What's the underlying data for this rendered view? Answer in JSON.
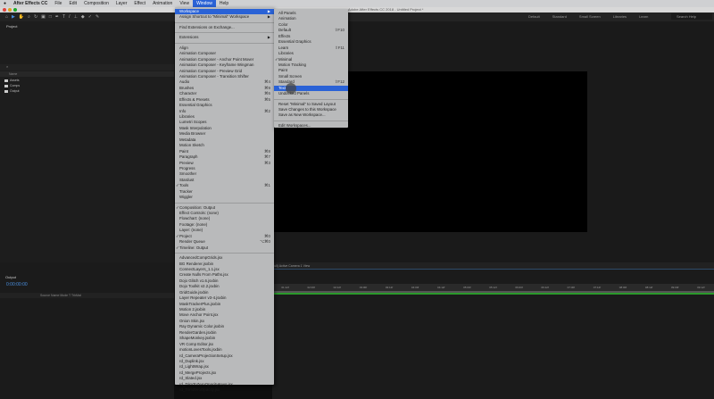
{
  "menubar": {
    "apple": "",
    "app": "After Effects CC",
    "items": [
      "File",
      "Edit",
      "Composition",
      "Layer",
      "Effect",
      "Animation",
      "View",
      "Window",
      "Help"
    ],
    "active": "Window"
  },
  "titlebar": {
    "title": "Adobe After Effects CC 2018 - Untitled Project *"
  },
  "toolbar": {
    "workspaces": [
      "Default",
      "Standard",
      "Small Screen",
      "Libraries",
      "Learn"
    ],
    "search_placeholder": "Search Help"
  },
  "project": {
    "tab": "Project",
    "column": "Name",
    "items": [
      "Assets",
      "Comps",
      "Output"
    ]
  },
  "viewer": {
    "toolbar": "(Full)   Active Camera   1 View"
  },
  "timeline": {
    "tab": "Output",
    "timecode": "0:00:00:00",
    "columns": "Source Name          Mode     T  TrkMat",
    "ruler": [
      "01:12f",
      "02:00f",
      "02:12f",
      "03:00f",
      "03:12f",
      "04:00f",
      "04:12f",
      "05:00f",
      "05:12f",
      "06:00f",
      "06:12f",
      "07:00f",
      "07:12f",
      "08:00f",
      "08:12f",
      "09:00f",
      "09:12f"
    ]
  },
  "window_menu": [
    {
      "label": "Workspace",
      "submenu": true,
      "highlight": true
    },
    {
      "label": "Assign Shortcut to \"Minimal\" Workspace",
      "submenu": true
    },
    {
      "sep": true
    },
    {
      "label": "Find Extensions on Exchange..."
    },
    {
      "sep": true
    },
    {
      "label": "Extensions",
      "submenu": true
    },
    {
      "sep": true
    },
    {
      "label": "Align"
    },
    {
      "label": "Animation Composer"
    },
    {
      "label": "Animation Composer - Anchor Point Mover"
    },
    {
      "label": "Animation Composer - Keyframe Wingman"
    },
    {
      "label": "Animation Composer - Preview Grid"
    },
    {
      "label": "Animation Composer - Transition Shifter"
    },
    {
      "label": "Audio",
      "shortcut": "⌘4"
    },
    {
      "label": "Brushes",
      "shortcut": "⌘9"
    },
    {
      "label": "Character",
      "shortcut": "⌘6"
    },
    {
      "label": "Effects & Presets",
      "shortcut": "⌘5"
    },
    {
      "label": "Essential Graphics"
    },
    {
      "label": "Info",
      "shortcut": "⌘2"
    },
    {
      "label": "Libraries"
    },
    {
      "label": "Lumetri Scopes"
    },
    {
      "label": "Mask Interpolation"
    },
    {
      "label": "Media Browser"
    },
    {
      "label": "Metadata"
    },
    {
      "label": "Motion Sketch"
    },
    {
      "label": "Paint",
      "shortcut": "⌘8"
    },
    {
      "label": "Paragraph",
      "shortcut": "⌘7"
    },
    {
      "label": "Preview",
      "shortcut": "⌘3"
    },
    {
      "label": "Progress"
    },
    {
      "label": "Smoother"
    },
    {
      "label": "Stardust"
    },
    {
      "label": "Tools",
      "shortcut": "⌘1",
      "checked": true
    },
    {
      "label": "Tracker"
    },
    {
      "label": "Wiggler"
    },
    {
      "sep": true
    },
    {
      "label": "Composition: Output",
      "checked": true
    },
    {
      "label": "Effect Controls: (none)"
    },
    {
      "label": "Flowchart: (none)"
    },
    {
      "label": "Footage: (none)"
    },
    {
      "label": "Layer: (none)"
    },
    {
      "label": "Project",
      "shortcut": "⌘0",
      "checked": true
    },
    {
      "label": "Render Queue",
      "shortcut": "⌥⌘0"
    },
    {
      "label": "Timeline: Output",
      "checked": true
    },
    {
      "sep": true
    },
    {
      "label": "AdvancedCompGrids.jsx"
    },
    {
      "label": "BG Renderer.jsxbin"
    },
    {
      "label": "ConnectLayers_1.1.jsx"
    },
    {
      "label": "Create Nulls From Paths.jsx"
    },
    {
      "label": "Dojo Glitch v1.6.jsxbin"
    },
    {
      "label": "Dojo Toolkit v2.2.jsxbin"
    },
    {
      "label": "GridGuide.jsxbin"
    },
    {
      "label": "Layer Repeater v3-4.jsxbin"
    },
    {
      "label": "MaskTrackerPlus.jsxbin"
    },
    {
      "label": "Motion 2.jsxbin"
    },
    {
      "label": "Move Anchor Point.jsx"
    },
    {
      "label": "Onion Skin.jsx"
    },
    {
      "label": "Ray Dynamic Color.jsxbin"
    },
    {
      "label": "RenderGarden.jsxbin"
    },
    {
      "label": "ShapeMonkey.jsxbin"
    },
    {
      "label": "VR Comp Editor.jsx"
    },
    {
      "label": "motionLovesTools.jsxbin"
    },
    {
      "label": "rd_CameraProjectionSetup.jsx"
    },
    {
      "label": "rd_Duplink.jsx"
    },
    {
      "label": "rd_LightWrap.jsx"
    },
    {
      "label": "rd_MergeProjects.jsx"
    },
    {
      "label": "rd_Slated.jsx"
    },
    {
      "label": "rd_TrimToZeroOpacityKeys.jsx"
    },
    {
      "label": "rd_TrimZeroOpacity.jsx"
    }
  ],
  "workspace_menu": [
    {
      "label": "All Panels"
    },
    {
      "label": "Animation"
    },
    {
      "label": "Color"
    },
    {
      "label": "Default",
      "shortcut": "⇧F10"
    },
    {
      "label": "Effects"
    },
    {
      "label": "Essential Graphics"
    },
    {
      "label": "Learn",
      "shortcut": "⇧F11"
    },
    {
      "label": "Libraries"
    },
    {
      "label": "Minimal",
      "checked": true
    },
    {
      "label": "Motion Tracking"
    },
    {
      "label": "Paint"
    },
    {
      "label": "Small Screen"
    },
    {
      "label": "Standard",
      "shortcut": "⇧F12"
    },
    {
      "label": "Text",
      "highlight": true
    },
    {
      "label": "Undocked Panels"
    },
    {
      "sep": true
    },
    {
      "label": "Reset \"Minimal\" to Saved Layout"
    },
    {
      "label": "Save Changes to this Workspace"
    },
    {
      "label": "Save as New Workspace..."
    },
    {
      "sep": true
    },
    {
      "label": "Edit Workspaces..."
    }
  ],
  "colors": {
    "highlight": "#2a62d6",
    "menu_bg": "#b9babb",
    "timecode": "#4a8fe0"
  }
}
